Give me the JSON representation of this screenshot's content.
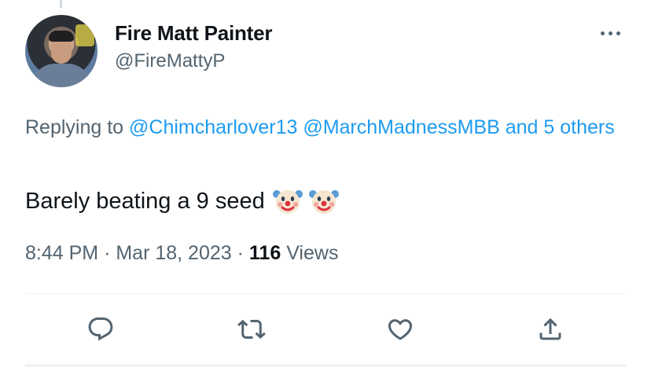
{
  "tweet": {
    "author_name": "Fire Matt Painter",
    "author_handle": "@FireMattyP",
    "replying_prefix": "Replying to",
    "replying_mentions": [
      "@Chimcharlover13",
      "@MarchMadnessMBB",
      "and 5 others"
    ],
    "text": "Barely beating a 9 seed",
    "emoji": [
      "clown-face",
      "clown-face"
    ],
    "time": "8:44 PM",
    "separator": "·",
    "date": "Mar 18, 2023",
    "views_count": "116",
    "views_label": "Views"
  },
  "actions": [
    "reply-icon",
    "retweet-icon",
    "like-icon",
    "share-icon"
  ],
  "colors": {
    "link": "#1d9bf0",
    "secondary": "#536471",
    "text": "#0f1419"
  }
}
